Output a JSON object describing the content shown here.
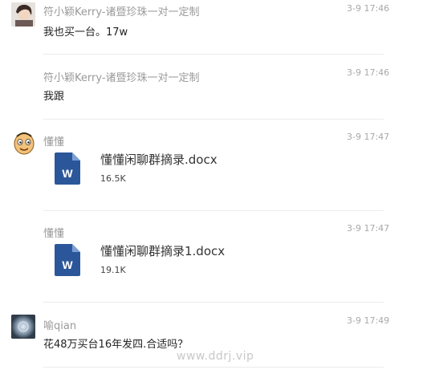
{
  "messages": [
    {
      "sender": "符小颖Kerry-诸暨珍珠一对一定制",
      "time": "3-9 17:46",
      "text": "我也买一台。17w"
    },
    {
      "sender": "符小颖Kerry-诸暨珍珠一对一定制",
      "time": "3-9 17:46",
      "text": "我跟"
    },
    {
      "sender": "懂懂",
      "time": "3-9 17:47",
      "file": {
        "name": "懂懂闲聊群摘录.docx",
        "size": "16.5K",
        "icon": "word-doc-icon",
        "icon_letter": "W"
      }
    },
    {
      "sender": "懂懂",
      "time": "3-9 17:47",
      "file": {
        "name": "懂懂闲聊群摘录1.docx",
        "size": "19.1K",
        "icon": "word-doc-icon",
        "icon_letter": "W"
      }
    },
    {
      "sender": "喻qian",
      "time": "3-9 17:49",
      "text": "花48万买台16年发四.合适吗？"
    }
  ],
  "watermark": "www.ddrj.vip",
  "colors": {
    "word_blue": "#2b579a",
    "sender_gray": "#9a9a9a"
  }
}
